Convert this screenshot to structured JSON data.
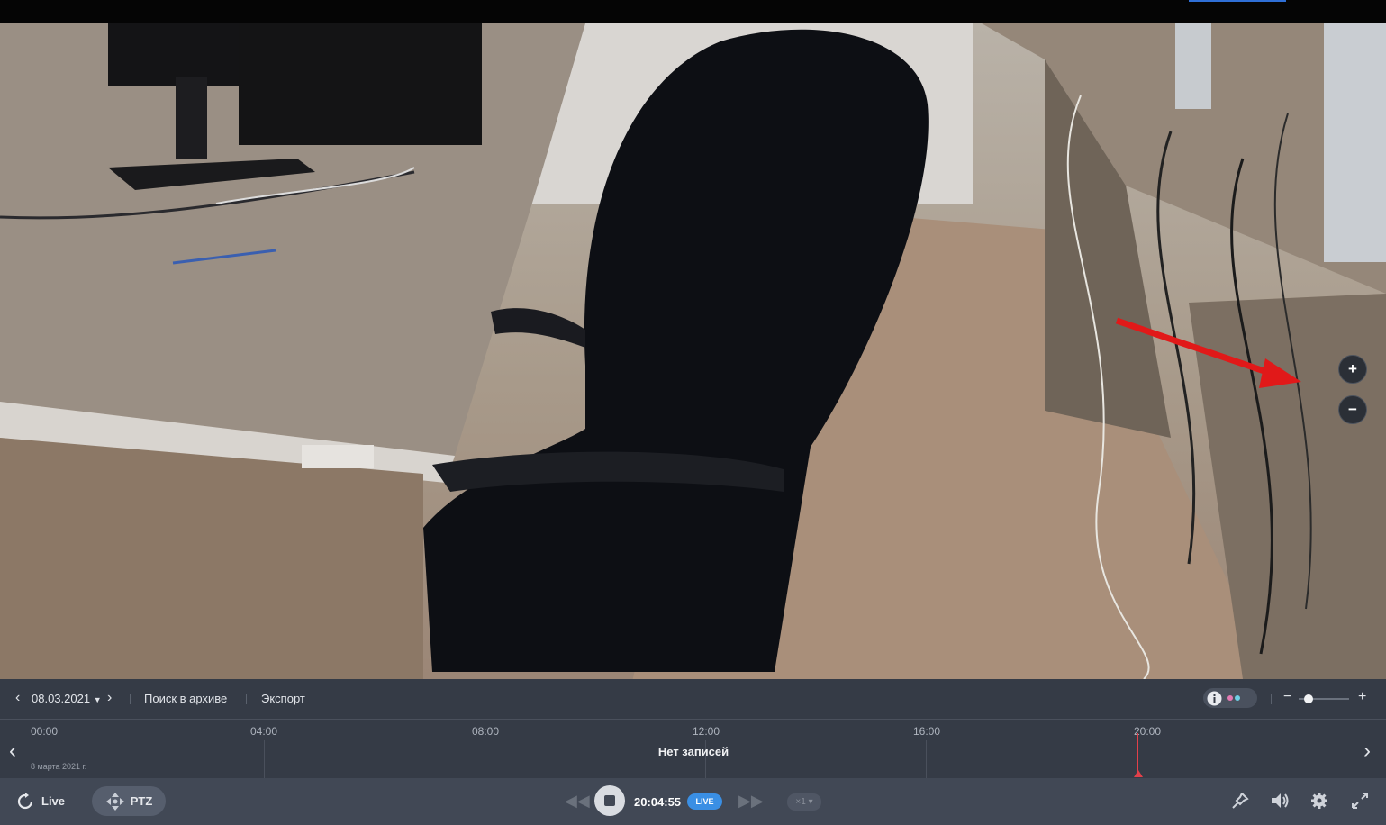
{
  "camera": {
    "zoom_in_label": "+",
    "zoom_out_label": "−"
  },
  "archive": {
    "date": "08.03.2021",
    "search_label": "Поиск в архиве",
    "export_label": "Экспорт",
    "timeline_hours": [
      "00:00",
      "04:00",
      "08:00",
      "12:00",
      "16:00",
      "20:00"
    ],
    "no_records_label": "Нет записей",
    "date_caption": "8 марта 2021 г.",
    "info_icon": "info-icon",
    "zoom_minus": "−",
    "zoom_plus": "+",
    "zoom_level": 0.2
  },
  "player": {
    "live_label": "Live",
    "ptz_label": "PTZ",
    "time": "20:04:55",
    "live_badge": "LIVE",
    "speed": "×1",
    "icons": [
      "pin-icon",
      "volume-icon",
      "settings-icon",
      "fullscreen-icon"
    ]
  }
}
